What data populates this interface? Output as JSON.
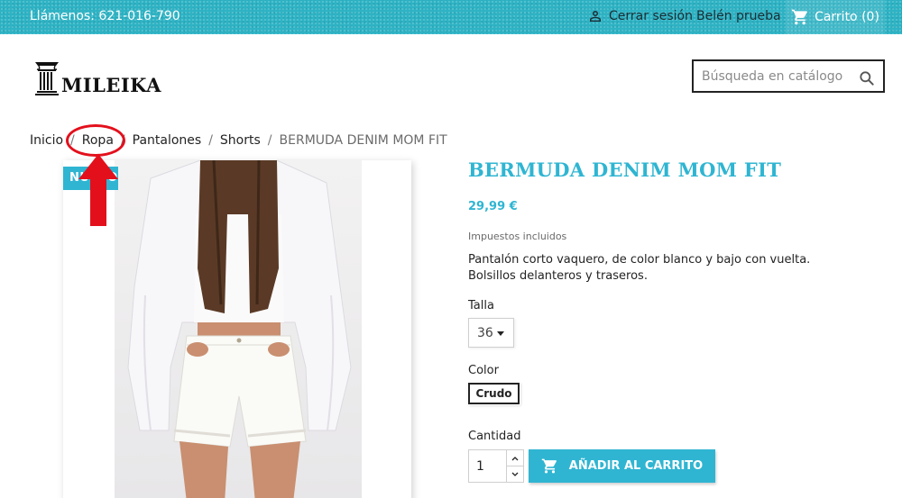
{
  "colors": {
    "accent": "#2fb5d2",
    "topbar": "#2eb3c4",
    "annotation": "#e3101c",
    "text": "#232323"
  },
  "topbar": {
    "phone": "Llámenos: 621-016-790",
    "logout_label": "Cerrar sesión",
    "logout_icon": "user-icon",
    "username": "Belén prueba",
    "cart_label": "Carrito (0)",
    "cart_icon": "shopping-cart-icon"
  },
  "header": {
    "logo_text": "MILEIKA",
    "logo_icon": "column-icon",
    "search_placeholder": "Búsqueda en catálogo",
    "search_icon": "search-icon"
  },
  "breadcrumb": {
    "items": [
      "Inicio",
      "Ropa",
      "Pantalones",
      "Shorts",
      "BERMUDA DENIM MOM FIT"
    ],
    "separator": "/"
  },
  "product": {
    "badge": "NUEVO",
    "title": "BERMUDA DENIM MOM FIT",
    "price": "29,99 €",
    "tax_note": "Impuestos incluidos",
    "description": "Pantalón corto vaquero, de color blanco y bajo con vuelta. Bolsillos delanteros y traseros.",
    "size_label": "Talla",
    "size_value": "36",
    "color_label": "Color",
    "color_value": "Crudo",
    "quantity_label": "Cantidad",
    "quantity_value": "1",
    "add_to_cart_label": "AÑADIR AL CARRITO",
    "add_to_cart_icon": "cart-plus-icon"
  }
}
